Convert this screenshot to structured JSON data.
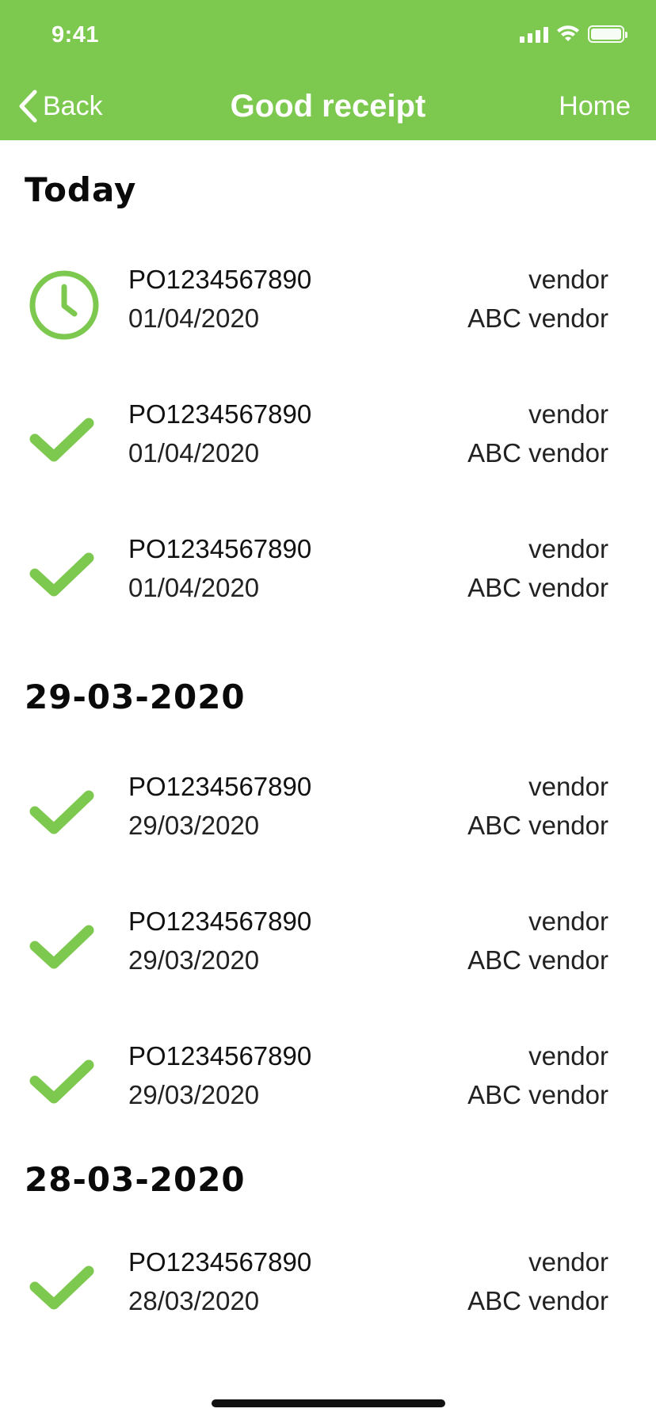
{
  "status_bar": {
    "time": "9:41"
  },
  "nav": {
    "back_label": "Back",
    "title": "Good receipt",
    "home_label": "Home"
  },
  "colors": {
    "brand": "#7dc94f",
    "icon": "#7dc94f"
  },
  "sections": [
    {
      "title": "Today",
      "rows": [
        {
          "icon": "clock-icon",
          "po": "PO1234567890",
          "date": "01/04/2020",
          "vendor_label": "vendor",
          "vendor": "ABC vendor"
        },
        {
          "icon": "checkmark-icon",
          "po": "PO1234567890",
          "date": "01/04/2020",
          "vendor_label": "vendor",
          "vendor": "ABC vendor"
        },
        {
          "icon": "checkmark-icon",
          "po": "PO1234567890",
          "date": "01/04/2020",
          "vendor_label": "vendor",
          "vendor": "ABC vendor"
        }
      ]
    },
    {
      "title": "29-03-2020",
      "rows": [
        {
          "icon": "checkmark-icon",
          "po": "PO1234567890",
          "date": "29/03/2020",
          "vendor_label": "vendor",
          "vendor": "ABC vendor"
        },
        {
          "icon": "checkmark-icon",
          "po": "PO1234567890",
          "date": "29/03/2020",
          "vendor_label": "vendor",
          "vendor": "ABC vendor"
        },
        {
          "icon": "checkmark-icon",
          "po": "PO1234567890",
          "date": "29/03/2020",
          "vendor_label": "vendor",
          "vendor": "ABC vendor"
        }
      ]
    },
    {
      "title": "28-03-2020",
      "rows": [
        {
          "icon": "checkmark-icon",
          "po": "PO1234567890",
          "date": "28/03/2020",
          "vendor_label": "vendor",
          "vendor": "ABC vendor"
        }
      ]
    }
  ]
}
